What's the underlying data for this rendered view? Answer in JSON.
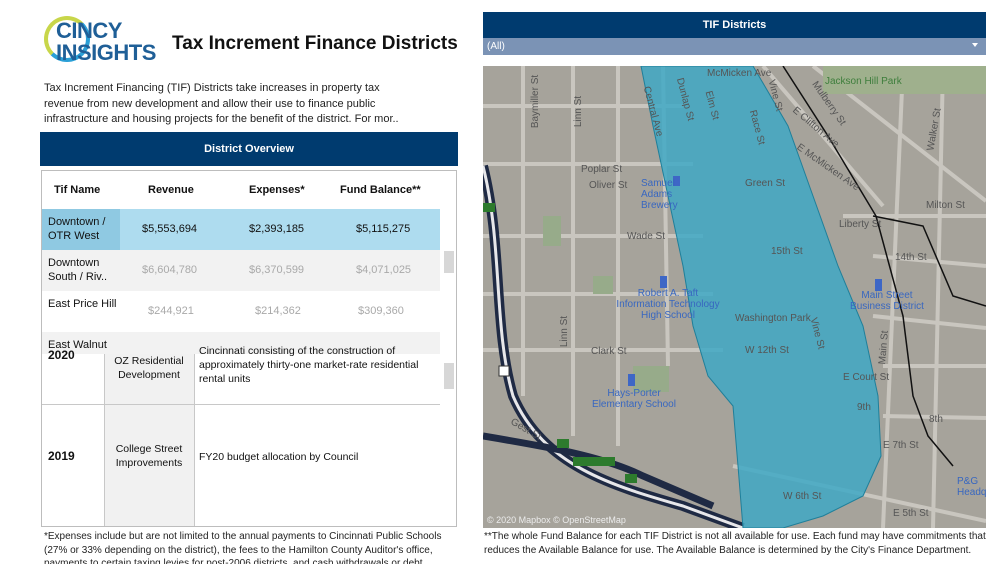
{
  "logo": {
    "line1": "CINCY",
    "line2": "INSIGHTS"
  },
  "title": "Tax Increment Finance Districts",
  "intro": "Tax Increment Financing (TIF) Districts take increases in property tax revenue from new development and allow their use to finance public infrastructure and housing projects for the benefit of the district. For mor..",
  "overview": {
    "header": "District Overview",
    "columns": [
      "Tif Name",
      "Revenue",
      "Expenses*",
      "Fund Balance**"
    ],
    "rows": [
      {
        "name": "Downtown / OTR West",
        "revenue": "$5,553,694",
        "expenses": "$2,393,185",
        "fund_balance": "$5,115,275"
      },
      {
        "name": "Downtown South / Riv..",
        "revenue": "$6,604,780",
        "expenses": "$6,370,599",
        "fund_balance": "$4,071,025"
      },
      {
        "name": "East Price Hill",
        "revenue": "$244,921",
        "expenses": "$214,362",
        "fund_balance": "$309,360"
      },
      {
        "name": "East Walnut"
      }
    ]
  },
  "projects": [
    {
      "year": "2020",
      "name": "OZ Residential Development",
      "description": "Cincinnati consisting of the construction of approximately thirty-one market-rate residential rental units"
    },
    {
      "year": "2019",
      "name": "College Street Improvements",
      "description": "FY20 budget allocation by Council"
    }
  ],
  "footnote_left": "*Expenses include but are not limited to the annual payments to Cincinnati Public Schools (27% or 33% depending on the district), the fees to the Hamilton County Auditor's office, payments to certain taxing levies for post-2006 districts, and cash withdrawals or debt",
  "map_panel": {
    "header": "TIF Districts",
    "filter_value": "(All)",
    "attribution": "© 2020 Mapbox © OpenStreetMap",
    "labels": {
      "jackson_hill": "Jackson Hill Park",
      "poplar": "Poplar St",
      "oliver": "Oliver St",
      "wade": "Wade St",
      "clark": "Clark St",
      "liberty": "Liberty St",
      "milton": "Milton St",
      "fourteenth": "14th St",
      "green": "Green St",
      "fifteenth": "15th St",
      "washington_park": "Washington Park",
      "w12th": "W 12th St",
      "e_court": "E Court St",
      "ninth": "9th",
      "eighth": "8th",
      "e7th": "E 7th St",
      "w6th": "W 6th St",
      "e5th": "E 5th St",
      "gest": "Gest St",
      "linn": "Linn St",
      "linn2": "Linn St",
      "baymiller": "Baymiller St",
      "central": "Central Ave",
      "dunlap": "Dunlap St",
      "elm": "Elm St",
      "race": "Race St",
      "vine": "Vine St",
      "vine2": "Vine St",
      "mulberry": "Mulberry St",
      "e_clifton": "E Clifton Ave",
      "e_mchenry": "E McMicken Ave",
      "walker": "Walker St",
      "main": "Main St",
      "samuel_adams": "Samuel Adams Brewery",
      "taft": "Robert A. Taft Information Technology High School",
      "hays_porter": "Hays-Porter Elementary School",
      "main_street": "Main Street Business District",
      "pg": "P&G Headquarters",
      "mcmicken_top": "McMicken Ave"
    }
  },
  "footnote_right": "**The whole Fund Balance for each TIF District is not all available for use. Each fund may have commitments that reduces the Available Balance for use. The Available Balance is determined by the City's Finance Department."
}
